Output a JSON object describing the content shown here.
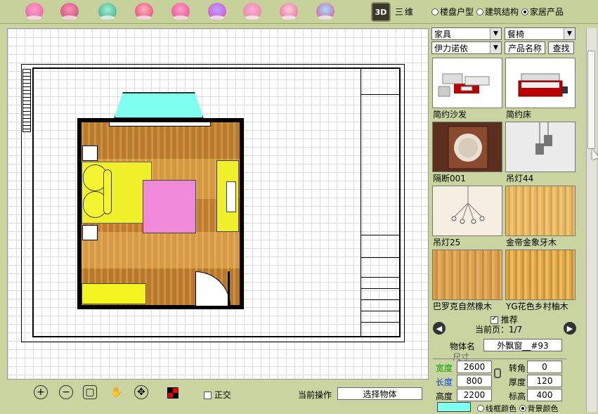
{
  "toolbar": {
    "icons": [
      "cake-icon",
      "bed-icon",
      "lamp-icon",
      "sofa-icon",
      "rose-icon",
      "shoe-icon",
      "candy-icon",
      "bowl-icon",
      "cup-icon",
      "paint-icon"
    ],
    "btn3d": "3D",
    "label3d": "三维",
    "radios": [
      {
        "label": "楼盘户型",
        "selected": false
      },
      {
        "label": "建筑结构",
        "selected": false
      },
      {
        "label": "家居产品",
        "selected": true
      }
    ]
  },
  "filters": {
    "category1": "家具",
    "category2": "餐椅",
    "brand": "伊力诺依",
    "product_name_placeholder": "产品名称",
    "search_label": "查找"
  },
  "products": [
    {
      "name": "简约沙发",
      "icon": "sofa-thumbnail"
    },
    {
      "name": "简约床",
      "icon": "bed-thumbnail"
    },
    {
      "name": "隔断001",
      "icon": "partition-thumbnail"
    },
    {
      "name": "吊灯44",
      "icon": "pendant-lamp-thumbnail"
    },
    {
      "name": "吊灯25",
      "icon": "chandelier-thumbnail"
    },
    {
      "name": "金帝金象牙木",
      "icon": "wood-texture-thumbnail"
    },
    {
      "name": "巴罗克自然橡木",
      "icon": "wood-texture-thumbnail"
    },
    {
      "name": "YG花色乡村柚木",
      "icon": "wood-texture-thumbnail"
    }
  ],
  "recommend": {
    "label": "推荐",
    "checked": true
  },
  "paging": {
    "label": "当前页：1/7"
  },
  "object": {
    "name_label": "物体名",
    "name_value": "外飘窗__#93",
    "size_section": "尺寸",
    "width_label": "宽度",
    "width_value": "2600",
    "length_label": "长度",
    "length_value": "800",
    "height_label": "高度",
    "height_value": "2200",
    "rotation_label": "转角",
    "rotation_value": "0",
    "thickness_label": "厚度",
    "thickness_value": "120",
    "elevation_label": "标高",
    "elevation_value": "400"
  },
  "colors": {
    "wireframe_label": "线框颜色",
    "background_label": "背景颜色",
    "wireframe_selected": false,
    "background_selected": true,
    "swatch": "#7fffef"
  },
  "bottom": {
    "orthogonal_label": "正交",
    "orthogonal_checked": false,
    "current_op_label": "当前操作",
    "current_op_value": "选择物体"
  },
  "plan": {
    "bay_window_color": "#7fffef",
    "bed_color": "#f0f02a",
    "rug_color": "#f08ad8",
    "floor_color": "#c98a3a"
  }
}
